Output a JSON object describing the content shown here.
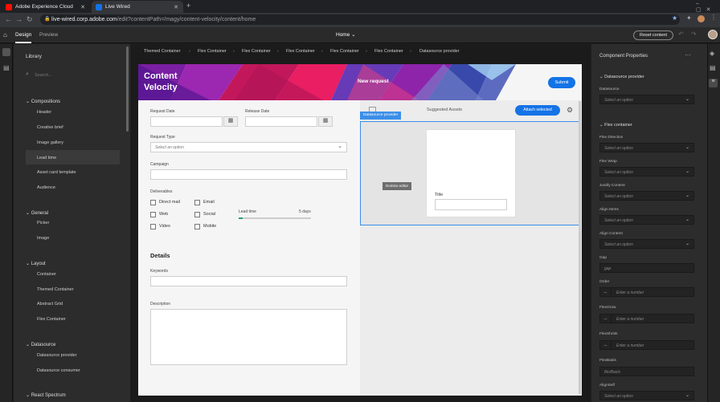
{
  "browser": {
    "tabs": [
      {
        "label": "Adobe Experience Cloud",
        "active": false,
        "color": "#fa0f00"
      },
      {
        "label": "Live Wired",
        "active": true,
        "color": "#1473e6"
      }
    ],
    "url_host": "live-wired.corp.adobe.com",
    "url_path": "/edit?contentPath=/magy/content-velocity/content/home"
  },
  "app": {
    "tabs": {
      "design": "Design",
      "preview": "Preview"
    },
    "page_selector": "Home",
    "reset_label": "Reset content"
  },
  "library": {
    "title": "Library",
    "search_placeholder": "Search...",
    "sections": [
      {
        "name": "Compositions",
        "items": [
          "Header",
          "Creative brief",
          "Image gallery",
          "Lead time",
          "Asset card template",
          "Audience"
        ]
      },
      {
        "name": "General",
        "items": [
          "Picker",
          "Image"
        ]
      },
      {
        "name": "Layout",
        "items": [
          "Container",
          "Themed Container",
          "Abstract Grid",
          "Flex Container"
        ]
      },
      {
        "name": "Datasource",
        "items": [
          "Datasource provider",
          "Datasource consumer"
        ]
      },
      {
        "name": "React Spectrum",
        "items": []
      }
    ]
  },
  "breadcrumb": [
    "Themed Container",
    "Flex Container",
    "Flex Container",
    "Flex Container",
    "Flex Container",
    "Flex Container",
    "Datasource provider"
  ],
  "page": {
    "banner_title": "Content Velocity",
    "new_request": "New request",
    "submit": "Submit",
    "request_date": "Request Date",
    "release_date": "Release Date",
    "request_type": "Request Type",
    "select_option": "Select an option",
    "campaign": "Campaign",
    "deliverables": "Deliverables",
    "checkboxes": [
      "Direct mail",
      "Email",
      "Web",
      "Social",
      "Video",
      "Mobile"
    ],
    "lead_time": "Lead time",
    "lead_time_value": "5 days",
    "lead_time_progress": 0.05,
    "details": "Details",
    "keywords": "Keywords",
    "description": "Description",
    "suggested_assets": "Suggested Assets",
    "attach_selected": "Attach selected",
    "ds_tag": "Datasource provider",
    "dom_inv": "Domino editor",
    "card_title": "Title"
  },
  "props": {
    "title": "Component Properties",
    "sec1": "Datasource provider",
    "datasource": "Datasource",
    "sec2": "Flex container",
    "fields": [
      "Flex Direction",
      "Flex Wrap",
      "Justify Content",
      "Align Items",
      "Align Content"
    ],
    "gap": "Gap",
    "gap_ph": "gap",
    "number_fields": [
      "Order",
      "FlexGrow",
      "FlexShrink"
    ],
    "enter_number": "Enter a number",
    "flexbasis": "FlexBasis",
    "flexbasis_ph": "flexBasis",
    "alignself": "AlignSelf",
    "select_option": "Select an option"
  }
}
